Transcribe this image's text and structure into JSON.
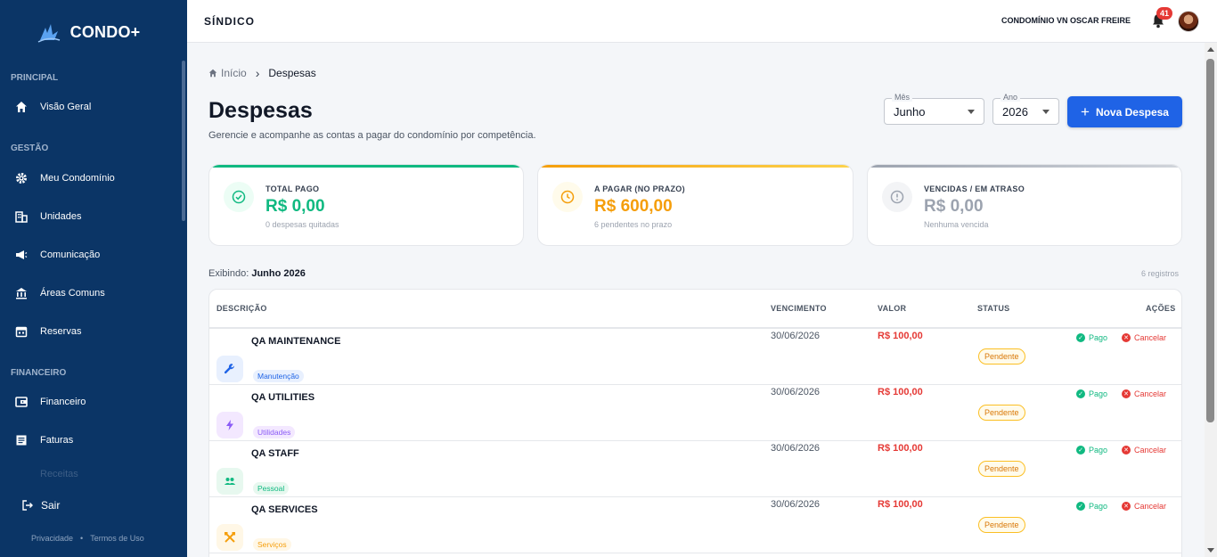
{
  "brand": {
    "name": "CONDO+"
  },
  "sidebar": {
    "sections": {
      "principal": "PRINCIPAL",
      "gestao": "GESTÃO",
      "financeiro": "FINANCEIRO"
    },
    "items": [
      {
        "label": "Visão Geral",
        "icon": "home-icon"
      },
      {
        "label": "Meu Condomínio",
        "icon": "gear-icon"
      },
      {
        "label": "Unidades",
        "icon": "building-icon"
      },
      {
        "label": "Comunicação",
        "icon": "megaphone-icon"
      },
      {
        "label": "Áreas Comuns",
        "icon": "bank-icon"
      },
      {
        "label": "Reservas",
        "icon": "calendar-icon"
      },
      {
        "label": "Financeiro",
        "icon": "wallet-icon"
      },
      {
        "label": "Faturas",
        "icon": "invoice-icon"
      },
      {
        "label": "Receitas",
        "icon": "receipt-icon"
      }
    ],
    "logout": "Sair",
    "footer": {
      "privacy": "Privacidade",
      "separator": "•",
      "terms": "Termos de Uso"
    }
  },
  "header": {
    "role": "SÍNDICO",
    "condo": "CONDOMÍNIO VN OSCAR FREIRE",
    "notifications": "41"
  },
  "breadcrumb": {
    "home": "Início",
    "current": "Despesas"
  },
  "page": {
    "title": "Despesas",
    "subtitle": "Gerencie e acompanhe as contas a pagar do condomínio por competência."
  },
  "filters": {
    "month_label": "Mês",
    "month_value": "Junho",
    "year_label": "Ano",
    "year_value": "2026",
    "new_button": "Nova Despesa"
  },
  "cards": [
    {
      "label": "TOTAL PAGO",
      "value": "R$ 0,00",
      "note": "0 despesas quitadas",
      "color": "#10b981",
      "icon": "check-circle-icon"
    },
    {
      "label": "A PAGAR (NO PRAZO)",
      "value": "R$ 600,00",
      "note": "6 pendentes no prazo",
      "color": "#f59e0b",
      "icon": "clock-icon"
    },
    {
      "label": "VENCIDAS / EM ATRASO",
      "value": "R$ 0,00",
      "note": "Nenhuma vencida",
      "color": "#9ca3af",
      "icon": "alert-circle-icon"
    }
  ],
  "listing": {
    "prefix": "Exibindo:",
    "period": "Junho 2026",
    "count": "6 registros"
  },
  "table": {
    "headers": {
      "descricao": "DESCRIÇÃO",
      "vencimento": "VENCIMENTO",
      "valor": "VALOR",
      "status": "STATUS",
      "acoes": "AÇÕES"
    },
    "pay_label": "Pago",
    "cancel_label": "Cancelar",
    "rows": [
      {
        "name": "QA MAINTENANCE",
        "category": "Manutenção",
        "date": "30/06/2026",
        "value": "R$ 100,00",
        "status": "Pendente",
        "icon": "wrench-icon"
      },
      {
        "name": "QA UTILITIES",
        "category": "Utilidades",
        "date": "30/06/2026",
        "value": "R$ 100,00",
        "status": "Pendente",
        "icon": "bolt-icon"
      },
      {
        "name": "QA STAFF",
        "category": "Pessoal",
        "date": "30/06/2026",
        "value": "R$ 100,00",
        "status": "Pendente",
        "icon": "people-icon"
      },
      {
        "name": "QA SERVICES",
        "category": "Serviços",
        "date": "30/06/2026",
        "value": "R$ 100,00",
        "status": "Pendente",
        "icon": "tools-icon"
      }
    ]
  }
}
